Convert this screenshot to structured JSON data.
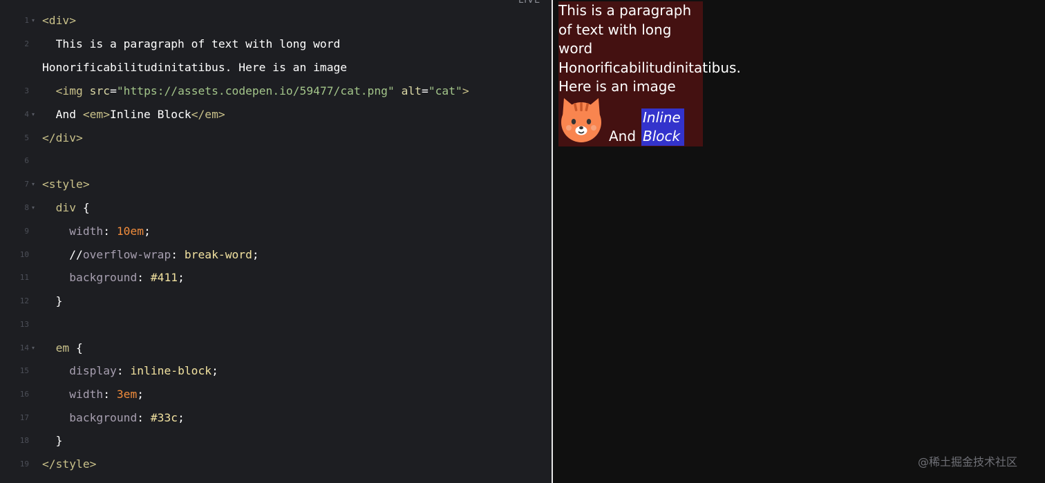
{
  "editor": {
    "live_label": "LIVE",
    "lines": {
      "l1": {
        "num": "1",
        "fold": "▾"
      },
      "l2": {
        "num": "2",
        "text_a": "  This is a paragraph of text with long word",
        "text_b": "Honorificabilitudinitatibus. Here is an image"
      },
      "l3": {
        "num": "3"
      },
      "l4": {
        "num": "4",
        "fold": "▾",
        "text_and": "  And ",
        "text_inline": "Inline Block"
      },
      "l5": {
        "num": "5"
      },
      "l6": {
        "num": "6"
      },
      "l7": {
        "num": "7",
        "fold": "▾"
      },
      "l8": {
        "num": "8",
        "fold": "▾"
      },
      "l9": {
        "num": "9"
      },
      "l10": {
        "num": "10"
      },
      "l11": {
        "num": "11"
      },
      "l12": {
        "num": "12"
      },
      "l13": {
        "num": "13"
      },
      "l14": {
        "num": "14",
        "fold": "▾"
      },
      "l15": {
        "num": "15"
      },
      "l16": {
        "num": "16"
      },
      "l17": {
        "num": "17"
      },
      "l18": {
        "num": "18"
      },
      "l19": {
        "num": "19"
      }
    },
    "tokens": {
      "div_open": "<div>",
      "div_close": "</div>",
      "img_open": "<img",
      "src_attr": "src",
      "src_value": "\"https://assets.codepen.io/59477/cat.png\"",
      "alt_attr": "alt",
      "alt_value": "\"cat\"",
      "img_close": ">",
      "em_open": "<em>",
      "em_close": "</em>",
      "style_open": "<style>",
      "style_close": "</style>",
      "div_selector": "div",
      "em_selector": "em",
      "brace_open": "{",
      "brace_close": "}",
      "width_prop": "width",
      "width_div_value": "10em",
      "comment_slashes": "//",
      "overflow_prop": "overflow-wrap",
      "overflow_value": "break-word",
      "background_prop": "background",
      "background_div_value": "#411",
      "display_prop": "display",
      "display_value": "inline-block",
      "width_em_value": "3em",
      "background_em_value": "#33c"
    }
  },
  "preview": {
    "paragraph": {
      "line1": "This is a paragraph",
      "line2": "of text with long",
      "line3": "word",
      "line4": "Honorificabilitudinitatibus.",
      "line5": "Here is an image"
    },
    "cat_alt": "cat",
    "and_text": "And",
    "em_line1": "Inline",
    "em_line2": "Block",
    "colors": {
      "div_background": "#441111",
      "em_background": "#3333cc",
      "cat_orange": "#f9854f"
    }
  },
  "watermark": "@稀土掘金技术社区"
}
